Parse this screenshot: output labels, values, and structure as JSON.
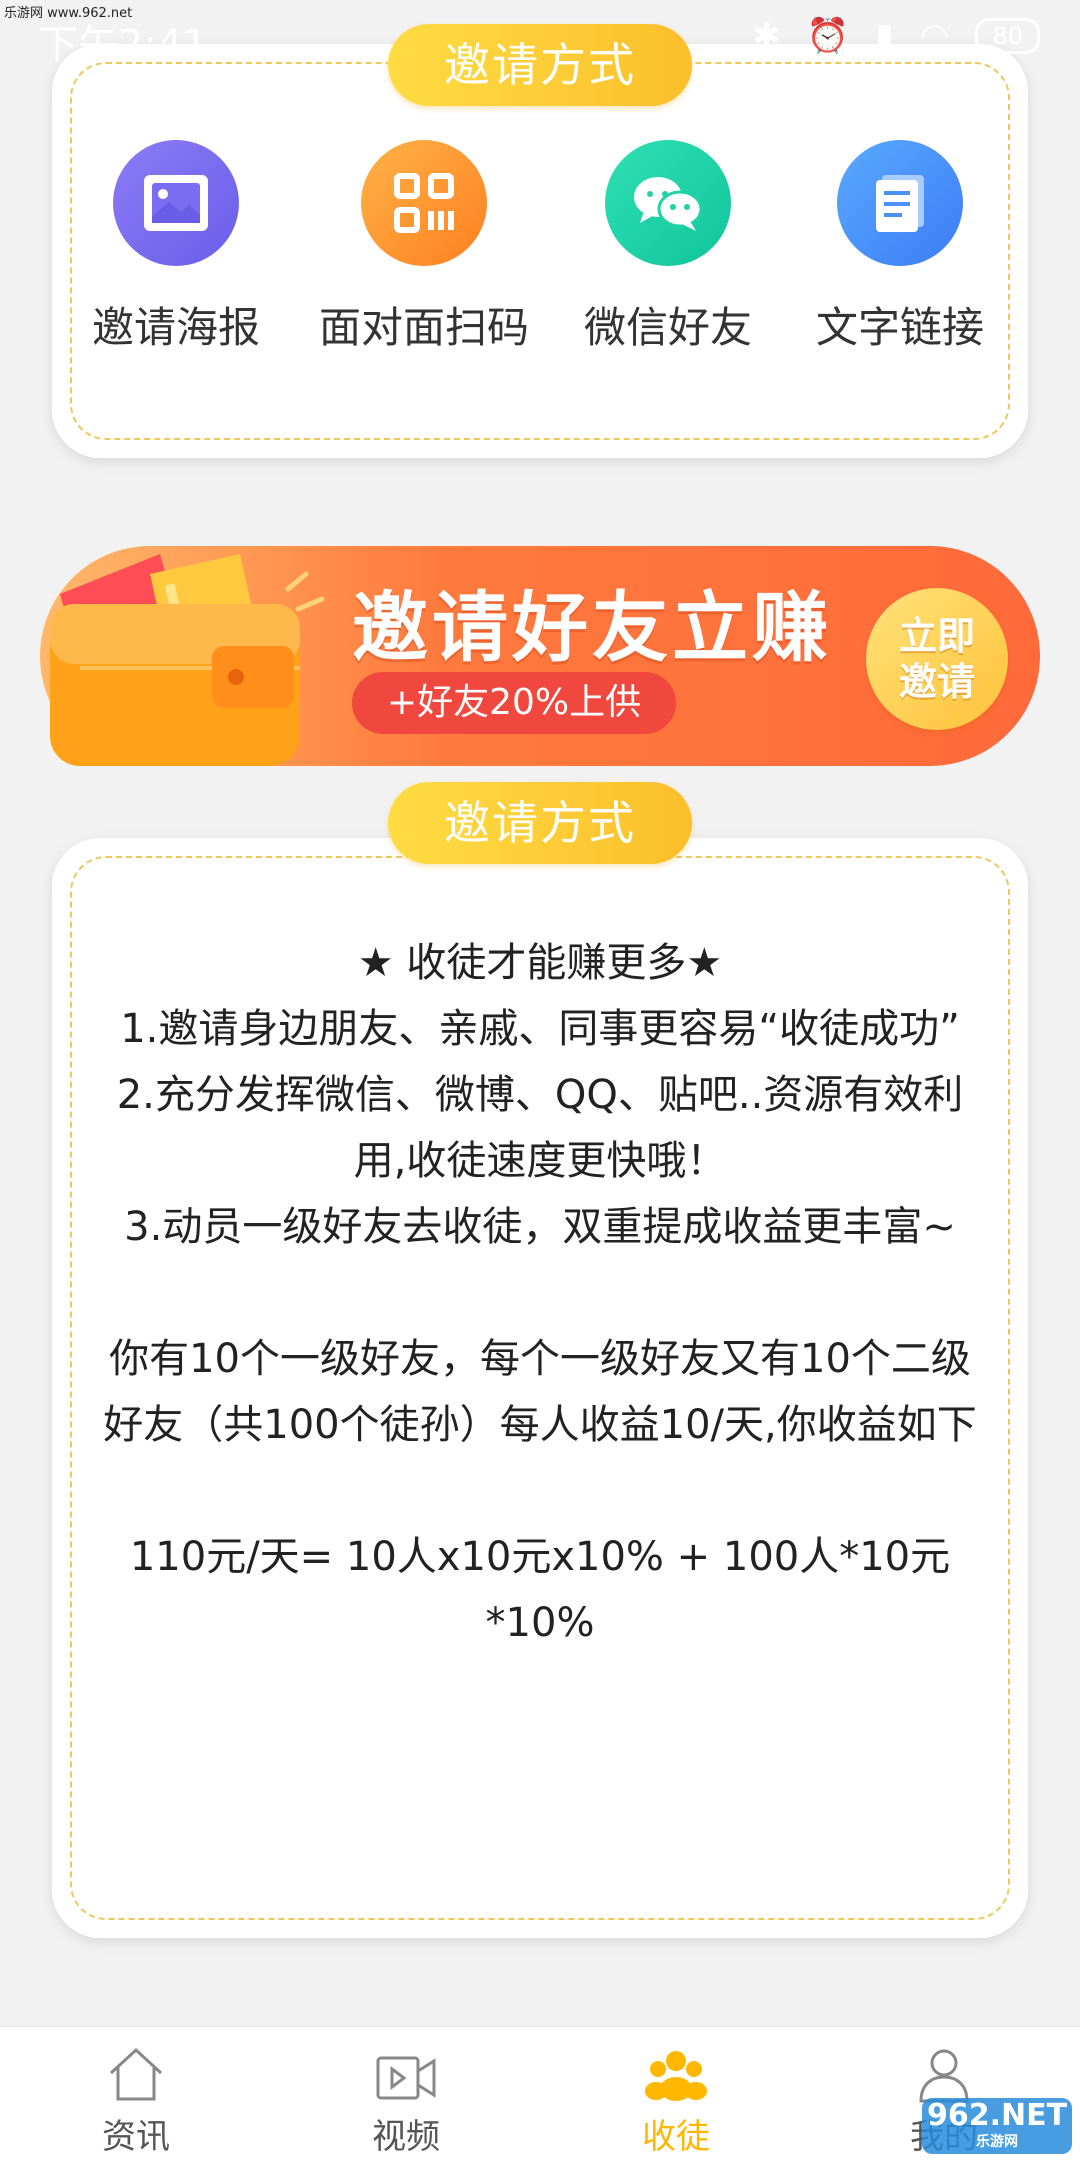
{
  "watermark_top": "乐游网 www.962.net",
  "status_bar": {
    "time": "下午2:41",
    "battery": "80"
  },
  "section1": {
    "title": "邀请方式",
    "methods": [
      {
        "label": "邀请海报",
        "icon": "image-icon",
        "color": "#7b6df1"
      },
      {
        "label": "面对面扫码",
        "icon": "qr-code-icon",
        "color": "#ff9a30"
      },
      {
        "label": "微信好友",
        "icon": "wechat-icon",
        "color": "#1fd3a6"
      },
      {
        "label": "文字链接",
        "icon": "document-icon",
        "color": "#4a90f7"
      }
    ]
  },
  "banner": {
    "title": "邀请好友立赚",
    "subtitle": "+好友20%上供",
    "button": "立即邀请"
  },
  "section2": {
    "title": "邀请方式",
    "headline": "★ 收徒才能赚更多★",
    "rule1": "1.邀请身边朋友、亲戚、同事更容易“收徒成功”",
    "rule2": "2.充分发挥微信、微博、QQ、贴吧..资源有效利用,收徒速度更快哦！",
    "rule3": "3.动员一级好友去收徒，双重提成收益更丰富~",
    "example": "你有10个一级好友，每个一级好友又有10个二级好友（共100个徒孙）每人收益10/天,你收益如下",
    "formula": "110元/天= 10人x10元x10% + 100人*10元*10%"
  },
  "tabbar": {
    "active": "收徒",
    "active_color": "#ffb700",
    "items": [
      {
        "label": "资讯",
        "icon": "home-icon"
      },
      {
        "label": "视频",
        "icon": "video-icon"
      },
      {
        "label": "收徒",
        "icon": "apprentice-icon"
      },
      {
        "label": "我的",
        "icon": "user-icon"
      }
    ]
  },
  "watermark_bottom": {
    "main": "962.NET",
    "sub": "乐游网"
  }
}
